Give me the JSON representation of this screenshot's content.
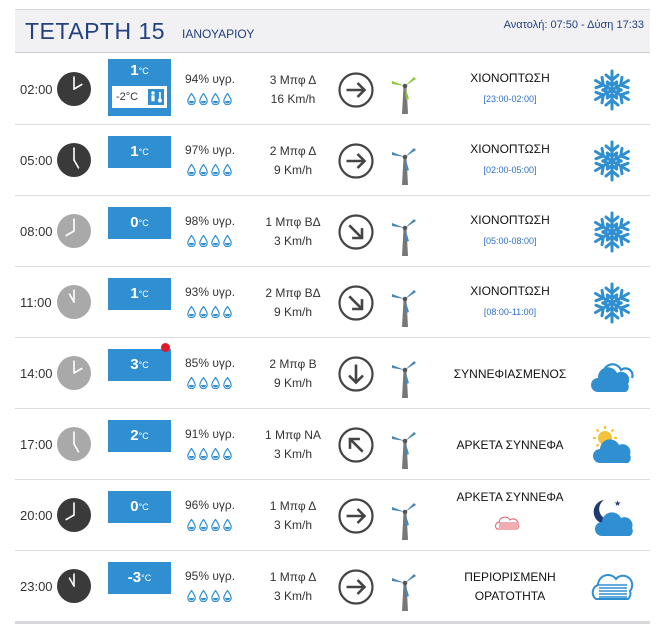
{
  "header": {
    "day": "ΤΕΤΑΡΤΗ 15",
    "month": "ΙΑΝΟΥΑΡΙΟΥ",
    "sun": "Ανατολή: 07:50  - Δύση 17:33"
  },
  "rows": [
    {
      "time": "02:00",
      "temp": "1",
      "feels": "-2°C",
      "unit": "°C",
      "humidity": "94% υγρ.",
      "wind_force": "3 Μπφ Δ",
      "wind_speed": "16 Km/h",
      "condition": "ΧΙΟΝΟΠΤΩΣΗ",
      "range": "[23:00-02:00]",
      "icon": "snowflake-icon",
      "arrow": "arrow-right-icon",
      "clock": "dark"
    },
    {
      "time": "05:00",
      "temp": "1",
      "unit": "°C",
      "humidity": "97% υγρ.",
      "wind_force": "2 Μπφ Δ",
      "wind_speed": "9 Km/h",
      "condition": "ΧΙΟΝΟΠΤΩΣΗ",
      "range": "[02:00-05:00]",
      "icon": "snowflake-icon",
      "arrow": "arrow-right-icon",
      "clock": "dark"
    },
    {
      "time": "08:00",
      "temp": "0",
      "unit": "°C",
      "humidity": "98% υγρ.",
      "wind_force": "1 Μπφ ΒΔ",
      "wind_speed": "3 Km/h",
      "condition": "ΧΙΟΝΟΠΤΩΣΗ",
      "range": "[05:00-08:00]",
      "icon": "snowflake-icon",
      "arrow": "arrow-down-right-icon",
      "clock": "light"
    },
    {
      "time": "11:00",
      "temp": "1",
      "unit": "°C",
      "humidity": "93% υγρ.",
      "wind_force": "2 Μπφ ΒΔ",
      "wind_speed": "9 Km/h",
      "condition": "ΧΙΟΝΟΠΤΩΣΗ",
      "range": "[08:00-11:00]",
      "icon": "snowflake-icon",
      "arrow": "arrow-down-right-icon",
      "clock": "light"
    },
    {
      "time": "14:00",
      "temp": "3",
      "unit": "°C",
      "humidity": "85% υγρ.",
      "wind_force": "2 Μπφ Β",
      "wind_speed": "9 Km/h",
      "condition": "ΣΥΝΝΕΦΙΑΣΜΕΝΟΣ",
      "icon": "cloud-icon",
      "arrow": "arrow-down-icon",
      "clock": "light"
    },
    {
      "time": "17:00",
      "temp": "2",
      "unit": "°C",
      "humidity": "91% υγρ.",
      "wind_force": "1 Μπφ ΝΑ",
      "wind_speed": "3 Km/h",
      "condition": "ΑΡΚΕΤΑ ΣΥΝΝΕΦΑ",
      "icon": "sun-cloud-icon",
      "arrow": "arrow-up-left-icon",
      "clock": "light"
    },
    {
      "time": "20:00",
      "temp": "0",
      "unit": "°C",
      "humidity": "96% υγρ.",
      "wind_force": "1 Μπφ Δ",
      "wind_speed": "3 Km/h",
      "condition": "ΑΡΚΕΤΑ ΣΥΝΝΕΦΑ",
      "icon": "moon-cloud-icon",
      "arrow": "arrow-right-icon",
      "clock": "dark"
    },
    {
      "time": "23:00",
      "temp": "-3",
      "unit": "°C",
      "humidity": "95% υγρ.",
      "wind_force": "1 Μπφ Δ",
      "wind_speed": "3 Km/h",
      "condition": "ΠΕΡΙΟΡΙΣΜΕΝΗ ΟΡΑΤΟΤΗΤΑ",
      "icon": "fog-icon",
      "arrow": "arrow-right-icon",
      "clock": "dark"
    }
  ],
  "colors": {
    "accent": "#2f8fd0",
    "title": "#23417e",
    "warning": "#e01a2a",
    "range": "#2f6fc4"
  }
}
